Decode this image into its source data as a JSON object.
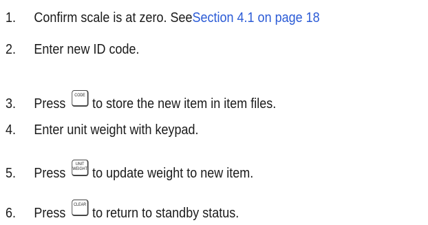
{
  "steps": [
    {
      "number": "1.",
      "text": "Confirm scale is at zero. See ",
      "link": "Section 4.1 on page 18"
    },
    {
      "number": "2.",
      "text": "Enter new ID code."
    },
    {
      "number": "3.",
      "before": "Press",
      "key": "CODE",
      "after": "to store the new item in item files."
    },
    {
      "number": "4.",
      "text": "Enter unit weight with keypad."
    },
    {
      "number": "5.",
      "before": "Press",
      "key_line1": "UNIT",
      "key_line2": "WEIGHT",
      "after": "to update weight to new item."
    },
    {
      "number": "6.",
      "before": "Press",
      "key": "CLEAR",
      "after": "to return to standby status."
    }
  ],
  "colors": {
    "link": "#2b5bd6",
    "text": "#1a1a1a"
  }
}
